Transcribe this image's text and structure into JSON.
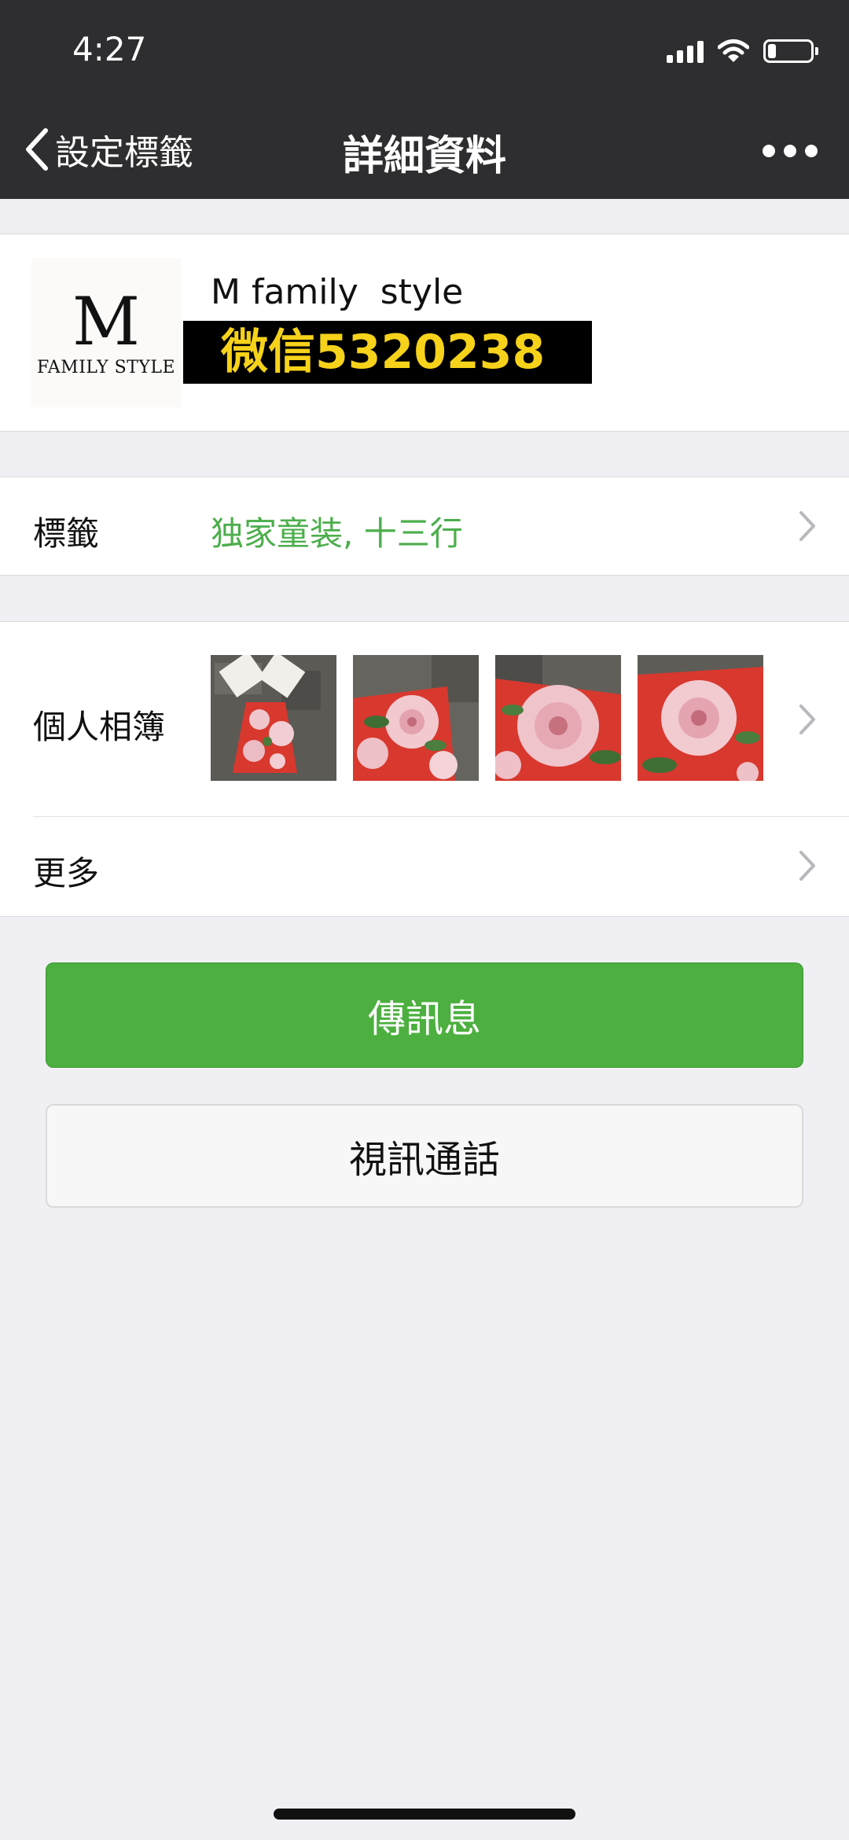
{
  "status_bar": {
    "time": "4:27",
    "icons": [
      "signal-icon",
      "wifi-icon",
      "battery-icon"
    ]
  },
  "nav": {
    "back_label": "設定標籤",
    "title": "詳細資料",
    "more_icon": "more-icon"
  },
  "profile": {
    "name": "M family  style",
    "avatar_letter": "M",
    "avatar_subtitle": "FAMILY STYLE",
    "wechat_overlay": "微信5320238"
  },
  "tags": {
    "label": "標籤",
    "value": "独家童装, 十三行"
  },
  "album": {
    "label": "個人相簿",
    "photo_count": 4
  },
  "more": {
    "label": "更多"
  },
  "buttons": {
    "send_message": "傳訊息",
    "video_call": "視訊通話"
  },
  "colors": {
    "nav_bg": "#2e2e30",
    "accent_green": "#4caf3f",
    "tag_green": "#4cae4c",
    "page_bg": "#efeff4",
    "overlay_yellow": "#f6d21a"
  }
}
